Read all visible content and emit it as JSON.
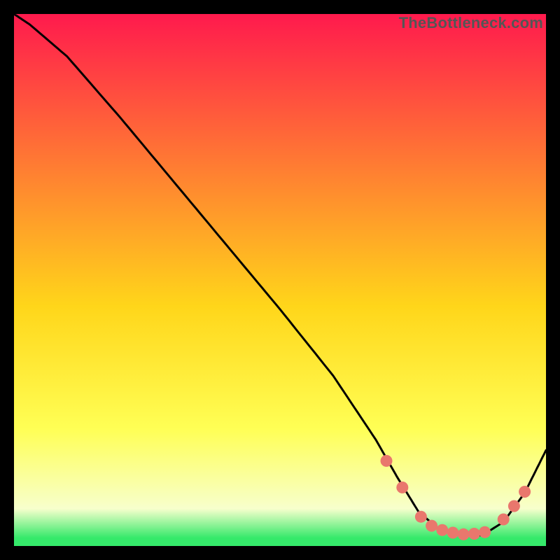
{
  "watermark": "TheBottleneck.com",
  "colors": {
    "bg_black": "#000000",
    "curve": "#000000",
    "marker_fill": "#e9776d",
    "marker_stroke": "#5ec45e",
    "grad_top": "#ff1a4d",
    "grad_mid1": "#ff7a33",
    "grad_mid2": "#ffd61a",
    "grad_mid3": "#ffff55",
    "grad_low": "#f7ffcc",
    "grad_bot": "#35e96a"
  },
  "chart_data": {
    "type": "line",
    "title": "",
    "xlabel": "",
    "ylabel": "",
    "xlim": [
      0,
      100
    ],
    "ylim": [
      0,
      100
    ],
    "grid": false,
    "legend": false,
    "series": [
      {
        "name": "bottleneck-curve",
        "x": [
          0,
          3,
          10,
          20,
          30,
          40,
          50,
          60,
          68,
          72,
          76,
          80,
          84,
          88,
          92,
          96,
          100
        ],
        "y": [
          100,
          98,
          92,
          80.5,
          68.5,
          56.5,
          44.5,
          32,
          20,
          13,
          6.5,
          3,
          2,
          2,
          4.5,
          10,
          18
        ]
      }
    ],
    "markers": {
      "name": "highlight-points",
      "x": [
        70,
        73,
        76.5,
        78.5,
        80.5,
        82.5,
        84.5,
        86.5,
        88.5,
        92,
        94,
        96
      ],
      "y": [
        16,
        11,
        5.5,
        3.8,
        3,
        2.5,
        2.2,
        2.3,
        2.6,
        5,
        7.5,
        10.2
      ]
    }
  }
}
